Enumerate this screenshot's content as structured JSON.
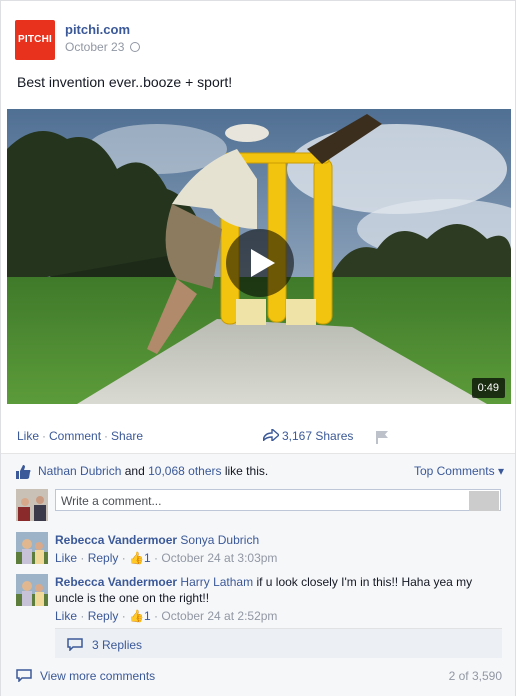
{
  "post": {
    "logo_text": "PITCHI",
    "page_name": "pitchi.com",
    "date": "October 23",
    "text": "Best invention ever..booze + sport!",
    "video_duration": "0:49",
    "accent": "#e8321d"
  },
  "actions": {
    "like": "Like",
    "comment": "Comment",
    "share": "Share",
    "sep": "·",
    "shares_count": "3,167 Shares"
  },
  "likes": {
    "name": "Nathan Dubrich",
    "and": "and",
    "others": "10,068 others",
    "suffix": "like this.",
    "top_comments": "Top Comments ▾"
  },
  "composer": {
    "placeholder": "Write a comment..."
  },
  "comments": [
    {
      "author": "Rebecca Vandermoer",
      "tag": "Sonya Dubrich",
      "text": "",
      "like": "Like",
      "reply": "Reply",
      "likes_count": "1",
      "time": "October 24 at 3:03pm"
    },
    {
      "author": "Rebecca Vandermoer",
      "tag": "Harry Latham",
      "text": "if u look closely I'm in this!! Haha yea my uncle is the one on the right!!",
      "like": "Like",
      "reply": "Reply",
      "likes_count": "1",
      "time": "October 24 at 2:52pm"
    }
  ],
  "replies": {
    "label": "3 Replies"
  },
  "more": {
    "label": "View more comments",
    "count": "2 of 3,590"
  }
}
